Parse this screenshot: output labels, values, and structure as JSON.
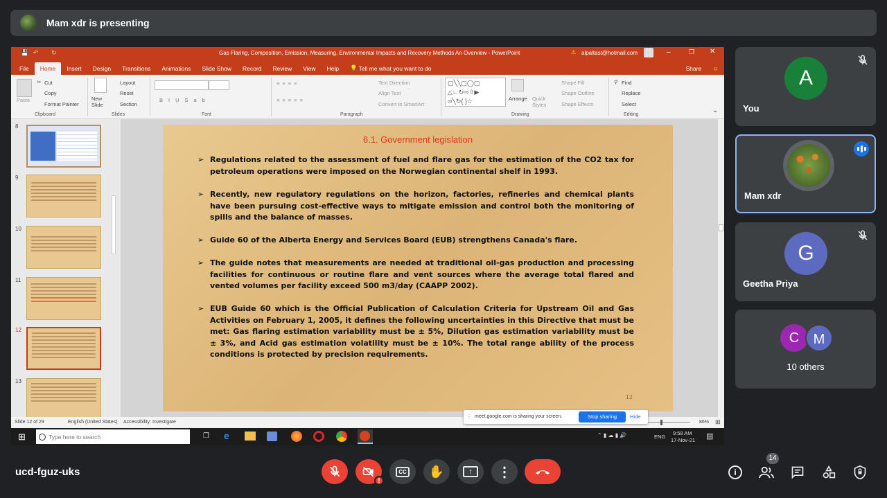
{
  "meet": {
    "presenting_text": "Mam xdr is presenting",
    "meeting_code": "ucd-fguz-uks",
    "participant_count": "14"
  },
  "participants": [
    {
      "name": "You",
      "initial": "A",
      "color": "#188038"
    },
    {
      "name": "Mam xdr"
    },
    {
      "name": "Geetha Priya",
      "initial": "G",
      "color": "#5c6bc0"
    },
    {
      "name": "10 others",
      "initials": [
        "C",
        "M"
      ]
    }
  ],
  "ppt": {
    "title": "Gas Flaring, Composition, Emission, Measuring, Environmental Impacts and Recovery Methods An Overview  -  PowerPoint",
    "user": "alpaltast@hotmail.com",
    "tabs": [
      "File",
      "Home",
      "Insert",
      "Design",
      "Transitions",
      "Animations",
      "Slide Show",
      "Record",
      "Review",
      "View",
      "Help"
    ],
    "tell_me": "Tell me what you want to do",
    "share": "Share",
    "ribbon": {
      "clipboard": {
        "paste": "Paste",
        "cut": "Cut",
        "copy": "Copy",
        "format_painter": "Format Painter",
        "label": "Clipboard"
      },
      "slides": {
        "new_slide": "New Slide",
        "layout": "Layout",
        "reset": "Reset",
        "section": "Section",
        "label": "Slides"
      },
      "font_label": "Font",
      "paragraph": {
        "text_direction": "Text Direction",
        "align_text": "Align Text",
        "convert": "Convert to SmartArt",
        "label": "Paragraph"
      },
      "drawing": {
        "arrange": "Arrange",
        "quick_styles": "Quick Styles",
        "shape_fill": "Shape Fill",
        "shape_outline": "Shape Outline",
        "shape_effects": "Shape Effects",
        "label": "Drawing"
      },
      "editing": {
        "find": "Find",
        "replace": "Replace",
        "select": "Select",
        "label": "Editing"
      }
    },
    "thumb_numbers": [
      "8",
      "9",
      "10",
      "11",
      "12",
      "13"
    ],
    "status": {
      "slide": "Slide 12 of 29",
      "language": "English (United States)",
      "accessibility": "Accessibility: Investigate",
      "zoom": "86%"
    },
    "slide": {
      "title": "6.1. Government legislation",
      "page_number": "12",
      "bullets": [
        "Regulations related to the assessment of fuel and flare gas for the estimation of the CO2 tax for petroleum operations were imposed on the Norwegian continental shelf in 1993.",
        "Recently, new regulatory regulations on the horizon, factories, refineries and chemical plants have been pursuing cost-effective ways to mitigate emission and control both the monitoring of spills and the balance of masses.",
        "Guide 60 of the Alberta Energy and Services Board (EUB) strengthens Canada's flare.",
        "The guide notes that measurements are needed at traditional oil-gas production and processing facilities for continuous or routine flare and vent sources where the average total flared and vented volumes per facility exceed 500 m3/day (CAAPP 2002).",
        "EUB Guide 60 which is the Official Publication of Calculation Criteria for Upstream Oil and Gas Activities on February 1, 2005, it defines the following uncertainties in this Directive that must be met: Gas flaring estimation variability must be ± 5%, Dilution gas estimation variability must be ± 3%, and Acid gas estimation volatility must be ± 10%. The total range ability of the process conditions is protected by precision requirements."
      ]
    }
  },
  "share_notice": {
    "text": "meet.google.com is sharing your screen.",
    "stop": "Stop sharing",
    "hide": "Hide"
  },
  "taskbar": {
    "search_placeholder": "Type here to search",
    "lang": "ENG",
    "time": "9:58 AM",
    "date": "17-Nov-21"
  }
}
